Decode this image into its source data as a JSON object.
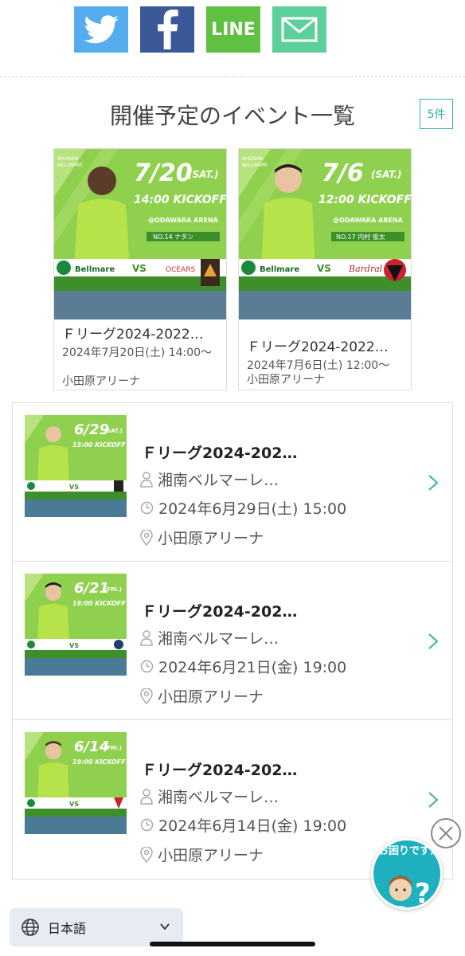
{
  "share": {
    "line_label": "LINE"
  },
  "section": {
    "title": "開催予定のイベント一覧",
    "count": "5件"
  },
  "cards": [
    {
      "date_big": "7/20",
      "dow": "(SAT.)",
      "kickoff": "14:00 KICKOFF",
      "arena": "@ODAWARA ARENA",
      "player": "NO.14 ナタン",
      "title": "Ｆリーグ2024-2022…",
      "datetime": "2024年7月20日(土) 14:00〜",
      "venue": "小田原アリーナ"
    },
    {
      "date_big": "7/6",
      "dow": "(SAT.)",
      "kickoff": "12:00 KICKOFF",
      "arena": "@ODAWARA ARENA",
      "player": "NO.17 内村 俊太",
      "title": "Ｆリーグ2024-2022…",
      "datetime": "2024年7月6日(土) 12:00〜",
      "venue": "小田原アリーナ"
    }
  ],
  "list": [
    {
      "thumb_date": "6/29",
      "thumb_dow": "(SAT.)",
      "thumb_kickoff": "15:00 KICKOFF",
      "title": "Ｆリーグ2024-202…",
      "organizer": "湘南ベルマーレ…",
      "datetime": "2024年6月29日(土) 15:00",
      "venue": "小田原アリーナ"
    },
    {
      "thumb_date": "6/21",
      "thumb_dow": "(FRI.)",
      "thumb_kickoff": "19:00 KICKOFF",
      "title": "Ｆリーグ2024-202…",
      "organizer": "湘南ベルマーレ…",
      "datetime": "2024年6月21日(金) 19:00",
      "venue": "小田原アリーナ"
    },
    {
      "thumb_date": "6/14",
      "thumb_dow": "(FRI.)",
      "thumb_kickoff": "19:00 KICKOFF",
      "title": "Ｆリーグ2024-202…",
      "organizer": "湘南ベルマーレ…",
      "datetime": "2024年6月14日(金) 19:00",
      "venue": "小田原アリーナ"
    }
  ],
  "language": {
    "label": "日本語"
  },
  "help": {
    "text": "お困りですか"
  },
  "colors": {
    "accent": "#37b0b0",
    "poster_green": "#8fd14f",
    "poster_dark_green": "#3d8f2a"
  }
}
